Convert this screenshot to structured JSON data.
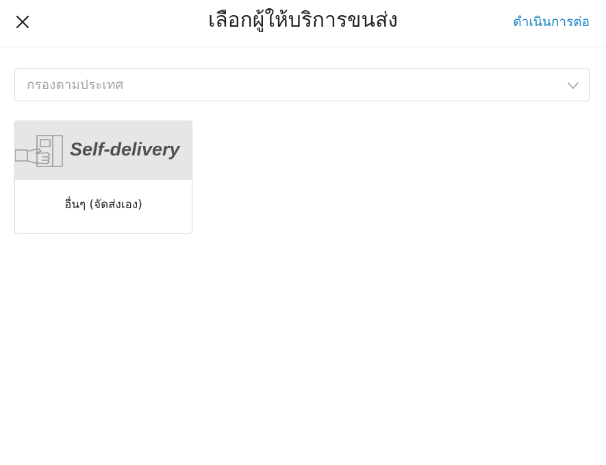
{
  "header": {
    "close_icon": "close-icon",
    "title": "เลือกผู้ให้บริการขนส่ง",
    "continue_label": "ดำเนินการต่อ",
    "accent_color": "#1a84c7"
  },
  "filter": {
    "placeholder": "กรองตามประเทศ",
    "chevron_icon": "chevron-down-icon"
  },
  "carriers": [
    {
      "logo_text": "Self-delivery",
      "logo_icon": "hand-package-icon",
      "name": "อื่นๆ (จัดส่งเอง)"
    }
  ]
}
